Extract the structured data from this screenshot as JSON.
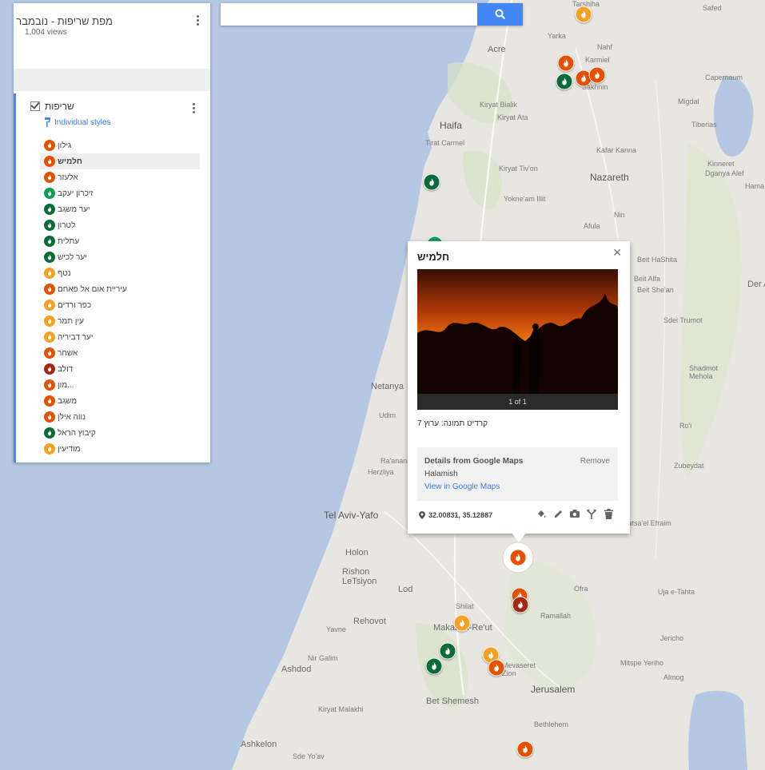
{
  "panel": {
    "title": "מפת שריפות - נובמבר",
    "views": "1,004 views",
    "layer_title": "שריפות",
    "styles_link": "Individual styles",
    "items": [
      {
        "label": "גילון",
        "color": "#e65100"
      },
      {
        "label": "חלמיש",
        "color": "#e65100"
      },
      {
        "label": "אלעזר",
        "color": "#e65100"
      },
      {
        "label": "זיכרון יעקב",
        "color": "#0f9d58"
      },
      {
        "label": "יער משגב",
        "color": "#0b6b3a"
      },
      {
        "label": "לטרון",
        "color": "#0b6b3a"
      },
      {
        "label": "עתלית",
        "color": "#0b6b3a"
      },
      {
        "label": "יער לכיש",
        "color": "#0b6b3a"
      },
      {
        "label": "נטף",
        "color": "#f4a020"
      },
      {
        "label": "עיריית אום אל פאחם",
        "color": "#e65100"
      },
      {
        "label": "כפר ורדים",
        "color": "#f4a020"
      },
      {
        "label": "עין תמר",
        "color": "#f4a020"
      },
      {
        "label": "יער דביריה",
        "color": "#f4a020"
      },
      {
        "label": "אשחר",
        "color": "#e65100"
      },
      {
        "label": "דולב",
        "color": "#a52714"
      },
      {
        "label": "מון...",
        "color": "#e65100"
      },
      {
        "label": "משגב",
        "color": "#e65100"
      },
      {
        "label": "נווה אילן",
        "color": "#e65100"
      },
      {
        "label": "קיבוץ הראל",
        "color": "#0b6b3a"
      },
      {
        "label": "מודיעין",
        "color": "#f4a020"
      }
    ]
  },
  "search": {
    "placeholder": "",
    "icon": "search-icon"
  },
  "popup": {
    "title": "חלמיש",
    "photo_counter": "1 of 1",
    "description": "קרדיט תמונה: ערוץ 7",
    "details_title": "Details from Google Maps",
    "remove_label": "Remove",
    "place_name": "Halamish",
    "view_link": "View in Google Maps",
    "coordinates": "32.00831, 35.12887"
  },
  "places": [
    {
      "name": "Safed"
    },
    {
      "name": "Yarka"
    },
    {
      "name": "Nahf"
    },
    {
      "name": "Acre"
    },
    {
      "name": "Karmiel"
    },
    {
      "name": "Capernaum"
    },
    {
      "name": "Sakhnin"
    },
    {
      "name": "Migdal"
    },
    {
      "name": "Kiryat Bialik"
    },
    {
      "name": "Kiryat Ata"
    },
    {
      "name": "Tiberias"
    },
    {
      "name": "Haifa"
    },
    {
      "name": "Tirat Carmel"
    },
    {
      "name": "Kafar Kanna"
    },
    {
      "name": "Kinneret"
    },
    {
      "name": "Dganya Alef"
    },
    {
      "name": "Kiryat Tiv'on"
    },
    {
      "name": "Nazareth"
    },
    {
      "name": "Yokne'am Illit"
    },
    {
      "name": "Hama"
    },
    {
      "name": "Nin"
    },
    {
      "name": "Afula"
    },
    {
      "name": "Beit HaShita"
    },
    {
      "name": "Beit Alfa"
    },
    {
      "name": "Beit She'an"
    },
    {
      "name": "Der A"
    },
    {
      "name": "Sdei Trumot"
    },
    {
      "name": "Shadmot Mehola"
    },
    {
      "name": "Netanya"
    },
    {
      "name": "Udim"
    },
    {
      "name": "Ro'i"
    },
    {
      "name": "Ra'anana"
    },
    {
      "name": "Herzliya"
    },
    {
      "name": "Zubeydat"
    },
    {
      "name": "Tel Aviv-Yafo"
    },
    {
      "name": "Fatsa'el Efraim"
    },
    {
      "name": "Holon"
    },
    {
      "name": "Rishon LeTsiyon"
    },
    {
      "name": "Lod"
    },
    {
      "name": "Ofra"
    },
    {
      "name": "Uja e-Tahta"
    },
    {
      "name": "Shilat"
    },
    {
      "name": "Ramallah"
    },
    {
      "name": "Rehovot"
    },
    {
      "name": "Makabim-Re'ut"
    },
    {
      "name": "Yavne"
    },
    {
      "name": "Jericho"
    },
    {
      "name": "Nir Galim"
    },
    {
      "name": "Mitspe Yeriho"
    },
    {
      "name": "Mevaseret Zion"
    },
    {
      "name": "Ashdod"
    },
    {
      "name": "Almog"
    },
    {
      "name": "Jerusalem"
    },
    {
      "name": "Bet Shemesh"
    },
    {
      "name": "Kiryat Malakhi"
    },
    {
      "name": "Bethlehem"
    },
    {
      "name": "Ashkelon"
    },
    {
      "name": "Sde Yo'av"
    },
    {
      "name": "Tarshiha"
    }
  ],
  "colors": {
    "accent": "#4285f4",
    "sea": "#b4c8e4",
    "land": "#e8e6e1"
  }
}
